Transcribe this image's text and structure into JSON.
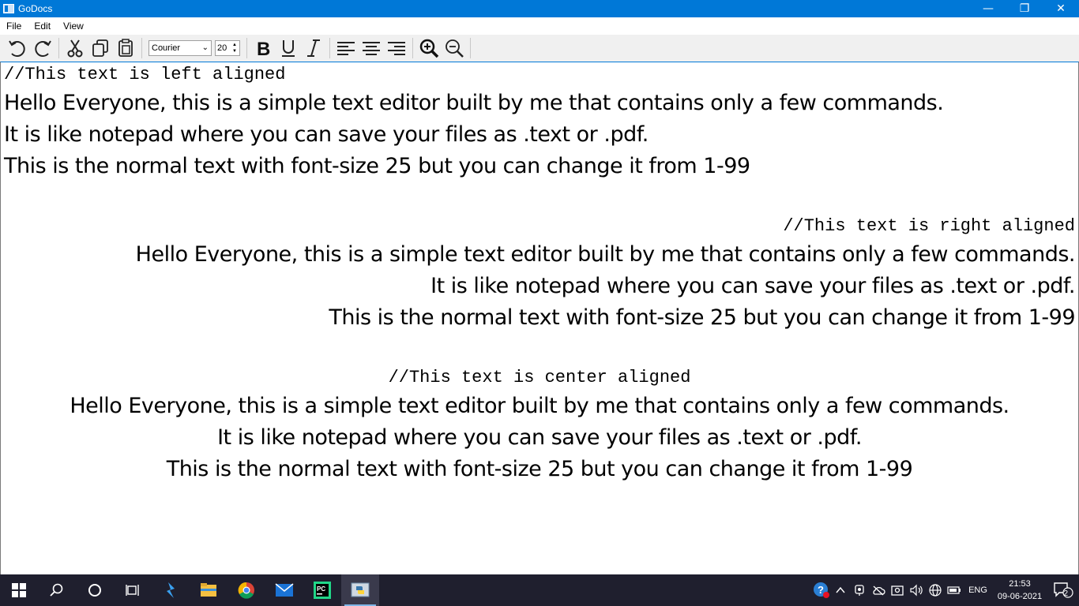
{
  "window": {
    "title": "GoDocs",
    "controls": {
      "minimize": "—",
      "restore": "❐",
      "close": "✕"
    }
  },
  "menu": {
    "items": [
      "File",
      "Edit",
      "View"
    ]
  },
  "toolbar": {
    "font_family": "Courier",
    "font_size": "20",
    "icons": [
      "undo-icon",
      "redo-icon",
      "cut-icon",
      "copy-icon",
      "paste-icon",
      "bold-icon",
      "underline-icon",
      "italic-icon",
      "align-left-icon",
      "align-center-icon",
      "align-right-icon",
      "zoom-in-icon",
      "zoom-out-icon"
    ]
  },
  "document": {
    "left": {
      "comment": "//This text is left aligned",
      "lines": [
        "Hello Everyone, this is a simple text editor built by me that contains only a few commands.",
        "It is like notepad where you can save your files as .text or .pdf.",
        "This is the normal text with font-size 25 but you can change it from 1-99"
      ]
    },
    "right": {
      "comment": "//This text is right aligned",
      "lines": [
        "Hello Everyone, this is a simple text editor built by me that contains only a few commands.",
        "It is like notepad where you can save your files as .text or .pdf.",
        "This is the normal text with font-size 25 but you can change it from 1-99"
      ]
    },
    "center": {
      "comment": "//This text is center aligned",
      "lines": [
        "Hello Everyone, this is a simple text editor built by me that contains only a few commands.",
        "It is like notepad where you can save your files as .text or .pdf.",
        "This is the normal text with font-size 25 but you can change it from 1-99"
      ]
    }
  },
  "taskbar": {
    "apps": [
      "windows-start-icon",
      "search-icon",
      "cortana-icon",
      "task-view-icon",
      "visual-studio-icon",
      "file-explorer-icon",
      "chrome-icon",
      "mail-icon",
      "pycharm-icon",
      "python-icon"
    ],
    "language": "ENG",
    "time": "21:53",
    "date": "09-06-2021",
    "notification_count": "2"
  }
}
